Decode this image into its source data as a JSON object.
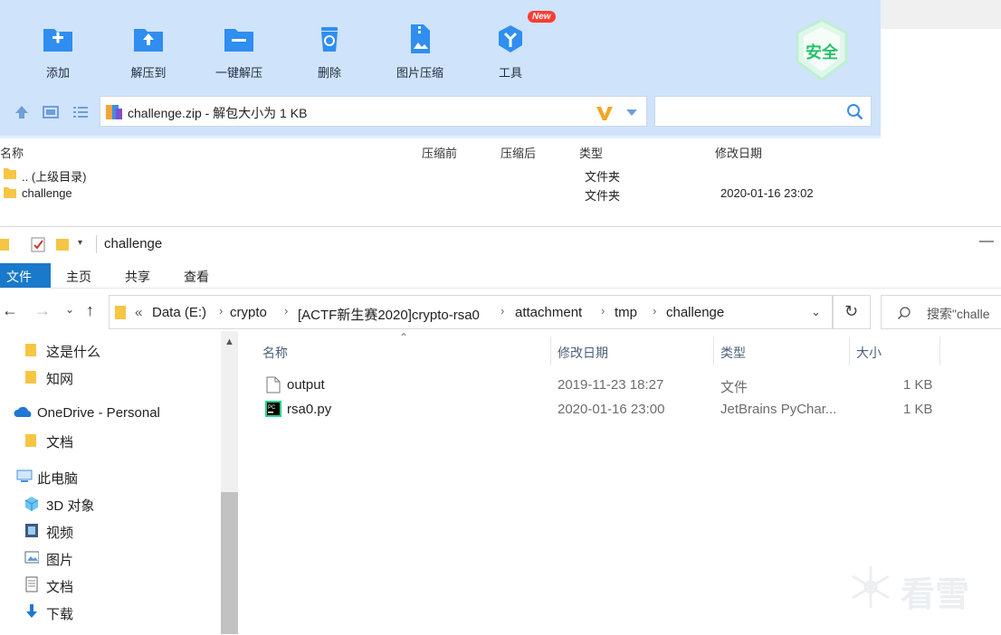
{
  "zip": {
    "toolbar": [
      {
        "label": "添加",
        "icon": "add-icon"
      },
      {
        "label": "解压到",
        "icon": "extract-to-icon"
      },
      {
        "label": "一键解压",
        "icon": "one-click-extract-icon"
      },
      {
        "label": "删除",
        "icon": "delete-icon"
      },
      {
        "label": "图片压缩",
        "icon": "image-compress-icon"
      },
      {
        "label": "工具",
        "icon": "tools-icon",
        "badge": "New"
      }
    ],
    "safe_badge": "安全",
    "path_text": "challenge.zip - 解包大小为 1 KB",
    "columns": {
      "name": "名称",
      "before": "压缩前",
      "after": "压缩后",
      "type": "类型",
      "modified": "修改日期"
    },
    "rows": [
      {
        "name": ".. (上级目录)",
        "type": "文件夹",
        "modified": ""
      },
      {
        "name": "challenge",
        "type": "文件夹",
        "modified": "2020-01-16 23:02"
      }
    ]
  },
  "explorer": {
    "title": "challenge",
    "ribbon": {
      "file": "文件",
      "home": "主页",
      "share": "共享",
      "view": "查看"
    },
    "breadcrumb": [
      "Data (E:)",
      "crypto",
      "[ACTF新生赛2020]crypto-rsa0",
      "attachment",
      "tmp",
      "challenge"
    ],
    "breadcrumb_prefix": "«",
    "search_placeholder": "搜索\"challe",
    "nav": [
      {
        "label": "这是什么",
        "icon": "folder-icon"
      },
      {
        "label": "知网",
        "icon": "folder-icon"
      },
      {
        "label": "OneDrive - Personal",
        "icon": "onedrive-icon"
      },
      {
        "label": "文档",
        "icon": "folder-icon"
      },
      {
        "label": "此电脑",
        "icon": "this-pc-icon"
      },
      {
        "label": "3D 对象",
        "icon": "3d-objects-icon"
      },
      {
        "label": "视频",
        "icon": "video-icon"
      },
      {
        "label": "图片",
        "icon": "pictures-icon"
      },
      {
        "label": "文档",
        "icon": "documents-icon"
      },
      {
        "label": "下载",
        "icon": "download-icon"
      }
    ],
    "columns": {
      "name": "名称",
      "modified": "修改日期",
      "type": "类型",
      "size": "大小"
    },
    "files": [
      {
        "name": "output",
        "modified": "2019-11-23 18:27",
        "type": "文件",
        "size": "1 KB",
        "icon": "file-icon"
      },
      {
        "name": "rsa0.py",
        "modified": "2020-01-16 23:00",
        "type": "JetBrains PyChar...",
        "size": "1 KB",
        "icon": "pycharm-icon"
      }
    ]
  },
  "watermark": {
    "text": "看雪"
  }
}
